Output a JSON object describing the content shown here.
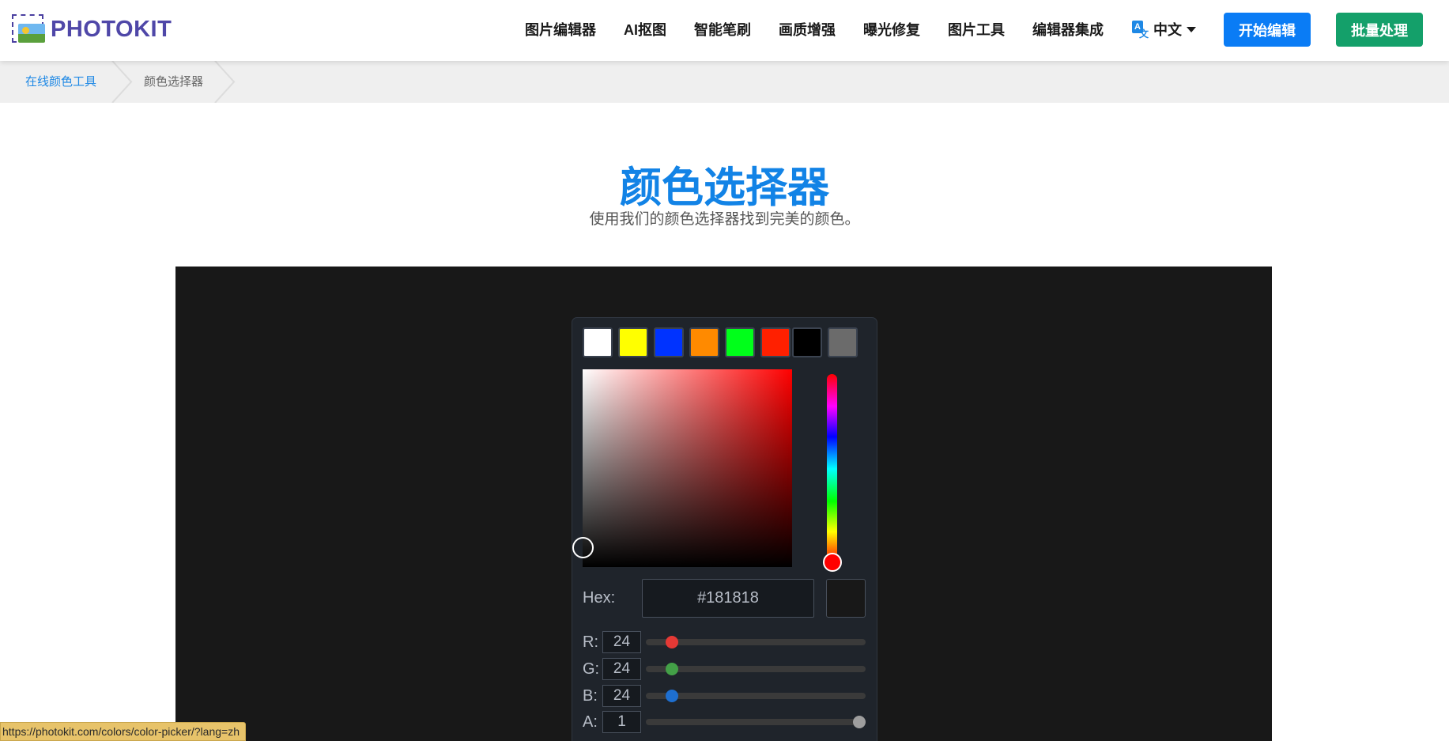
{
  "header": {
    "logo_text": "PHOTOKIT",
    "nav": [
      "图片编辑器",
      "AI抠图",
      "智能笔刷",
      "画质增强",
      "曝光修复",
      "图片工具",
      "编辑器集成"
    ],
    "language": "中文",
    "start_button": "开始编辑",
    "batch_button": "批量处理"
  },
  "breadcrumb": {
    "parent": "在线颜色工具",
    "current": "颜色选择器"
  },
  "page": {
    "title": "颜色选择器",
    "subtitle": "使用我们的颜色选择器找到完美的颜色。"
  },
  "picker": {
    "swatches": [
      "#ffffff",
      "#ffff00",
      "#0033ff",
      "#ff8a00",
      "#00ff1a",
      "#ff2000",
      "#000000",
      "#6b6b6b"
    ],
    "hex_label": "Hex:",
    "hex_value": "#181818",
    "channels": [
      {
        "label": "R:",
        "value": "24",
        "color": "#e53935",
        "fraction": 0.094
      },
      {
        "label": "G:",
        "value": "24",
        "color": "#43a047",
        "fraction": 0.094
      },
      {
        "label": "B:",
        "value": "24",
        "color": "#1e6fd0",
        "fraction": 0.094
      },
      {
        "label": "A:",
        "value": "1",
        "color": "#9e9e9e",
        "fraction": 1.0
      }
    ]
  },
  "status_url": "https://photokit.com/colors/color-picker/?lang=zh"
}
